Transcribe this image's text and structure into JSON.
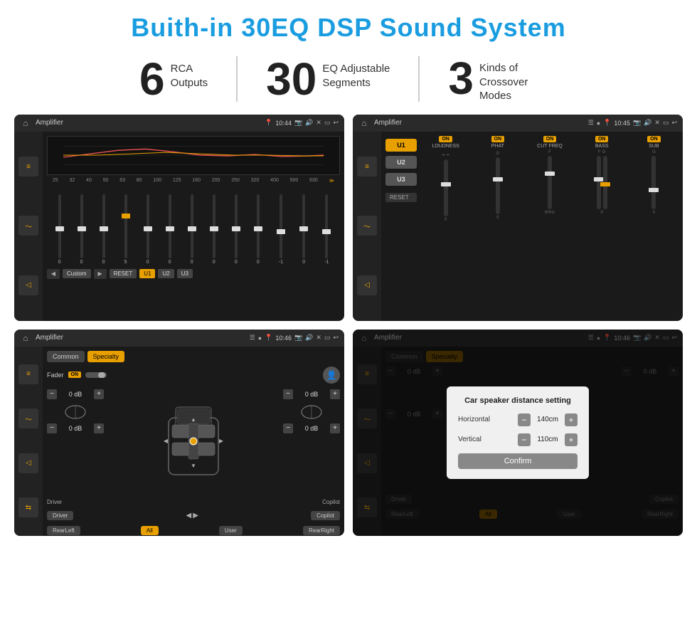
{
  "header": {
    "title": "Buith-in 30EQ DSP Sound System"
  },
  "stats": [
    {
      "number": "6",
      "label": "RCA\nOutputs"
    },
    {
      "number": "30",
      "label": "EQ Adjustable\nSegments"
    },
    {
      "number": "3",
      "label": "Kinds of\nCrossover Modes"
    }
  ],
  "screen1": {
    "title": "Amplifier",
    "time": "10:44",
    "eq_frequencies": [
      "25",
      "32",
      "40",
      "50",
      "63",
      "80",
      "100",
      "125",
      "160",
      "200",
      "250",
      "320",
      "400",
      "500",
      "630"
    ],
    "eq_values": [
      "0",
      "0",
      "0",
      "5",
      "0",
      "0",
      "0",
      "0",
      "0",
      "0",
      "-1",
      "0",
      "-1"
    ],
    "preset": "Custom",
    "buttons": [
      "RESET",
      "U1",
      "U2",
      "U3"
    ]
  },
  "screen2": {
    "title": "Amplifier",
    "time": "10:45",
    "presets": [
      "U1",
      "U2",
      "U3"
    ],
    "sections": [
      "LOUDNESS",
      "PHAT",
      "CUT FREQ",
      "BASS",
      "SUB"
    ],
    "reset_label": "RESET"
  },
  "screen3": {
    "title": "Amplifier",
    "time": "10:46",
    "tabs": [
      "Common",
      "Specialty"
    ],
    "active_tab": "Specialty",
    "fader_label": "Fader",
    "fader_on": "ON",
    "db_values": [
      "0 dB",
      "0 dB",
      "0 dB",
      "0 dB"
    ],
    "bottom_btns": [
      "Driver",
      "Copilot",
      "RearLeft",
      "All",
      "User",
      "RearRight"
    ]
  },
  "screen4": {
    "title": "Amplifier",
    "time": "10:46",
    "tabs": [
      "Common",
      "Specialty"
    ],
    "dialog": {
      "title": "Car speaker distance setting",
      "horizontal_label": "Horizontal",
      "horizontal_value": "140cm",
      "vertical_label": "Vertical",
      "vertical_value": "110cm",
      "confirm_label": "Confirm"
    },
    "db_values": [
      "0 dB",
      "0 dB"
    ],
    "bottom_btns": [
      "Driver",
      "Copilot",
      "RearLeft",
      "All",
      "User",
      "RearRight"
    ]
  }
}
